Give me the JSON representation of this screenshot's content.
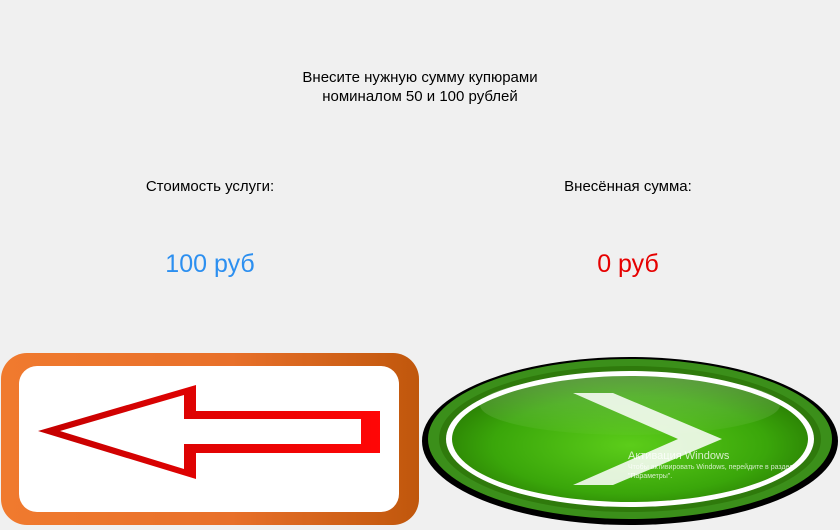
{
  "instruction": {
    "line1": "Внесите нужную сумму купюрами",
    "line2": "номиналом 50 и 100 рублей"
  },
  "service_cost": {
    "label": "Стоимость услуги:",
    "value": "100 руб",
    "color": "#2c8ff0"
  },
  "paid_amount": {
    "label": "Внесённая сумма:",
    "value": "0 руб",
    "color": "#e60000"
  },
  "buttons": {
    "back_icon": "left-arrow-icon",
    "next_icon": "chevron-right-icon"
  },
  "watermark": {
    "title": "Активация Windows",
    "line1": "Чтобы активировать Windows, перейдите в раздел",
    "line2": "\"Параметры\"."
  }
}
